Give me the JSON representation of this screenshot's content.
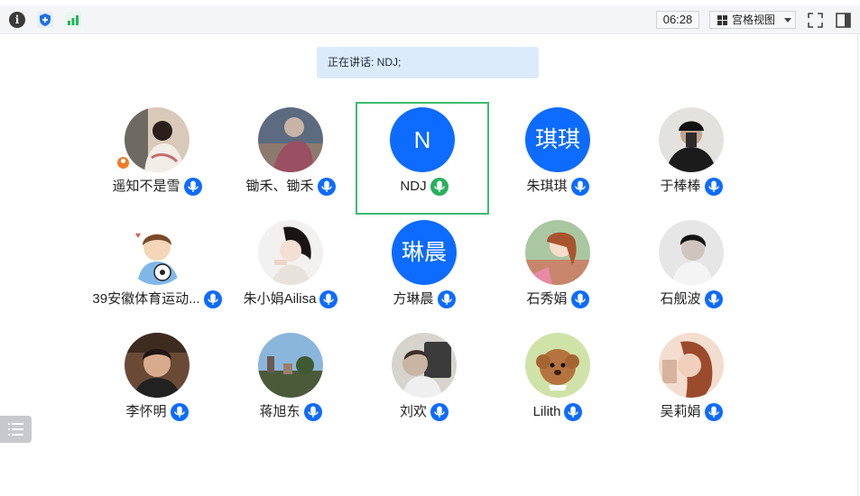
{
  "toolbar": {
    "icons": [
      "info-icon",
      "shield-icon",
      "signal-icon"
    ],
    "timer": "06:28",
    "view_label": "宫格视图",
    "right_icons": [
      "fullscreen-icon",
      "side-panel-icon"
    ]
  },
  "speaker_banner": "正在讲话: NDJ;",
  "colors": {
    "accent_blue": "#0d6bff",
    "active_border": "#3dbb6e",
    "speaking_mic": "#27b15c",
    "banner_bg": "#dcebfc"
  },
  "participants": [
    {
      "name": "遥知不是雪",
      "avatar": "photo",
      "host_badge": true,
      "mic": "idle"
    },
    {
      "name": "锄禾、锄禾",
      "avatar": "photo",
      "mic": "idle"
    },
    {
      "name": "NDJ",
      "avatar_text": "N",
      "mic": "speaking",
      "active": true
    },
    {
      "name": "朱琪琪",
      "avatar_text": "琪琪",
      "mic": "idle"
    },
    {
      "name": "于棒棒",
      "avatar": "photo",
      "mic": "idle"
    },
    {
      "name": "39安徽体育运动...",
      "avatar": "cartoon",
      "mic": "idle"
    },
    {
      "name": "朱小娟Ailisa",
      "avatar": "photo",
      "mic": "idle"
    },
    {
      "name": "方琳晨",
      "avatar_text": "琳晨",
      "mic": "idle"
    },
    {
      "name": "石秀娟",
      "avatar": "illustration",
      "mic": "idle"
    },
    {
      "name": "石舰波",
      "avatar": "photo",
      "mic": "idle"
    },
    {
      "name": "李怀明",
      "avatar": "photo",
      "mic": "idle"
    },
    {
      "name": "蒋旭东",
      "avatar": "photo",
      "mic": "idle"
    },
    {
      "name": "刘欢",
      "avatar": "photo",
      "mic": "idle"
    },
    {
      "name": "Lilith",
      "avatar": "illustration",
      "mic": "idle"
    },
    {
      "name": "吴莉娟",
      "avatar": "photo",
      "mic": "idle"
    }
  ]
}
